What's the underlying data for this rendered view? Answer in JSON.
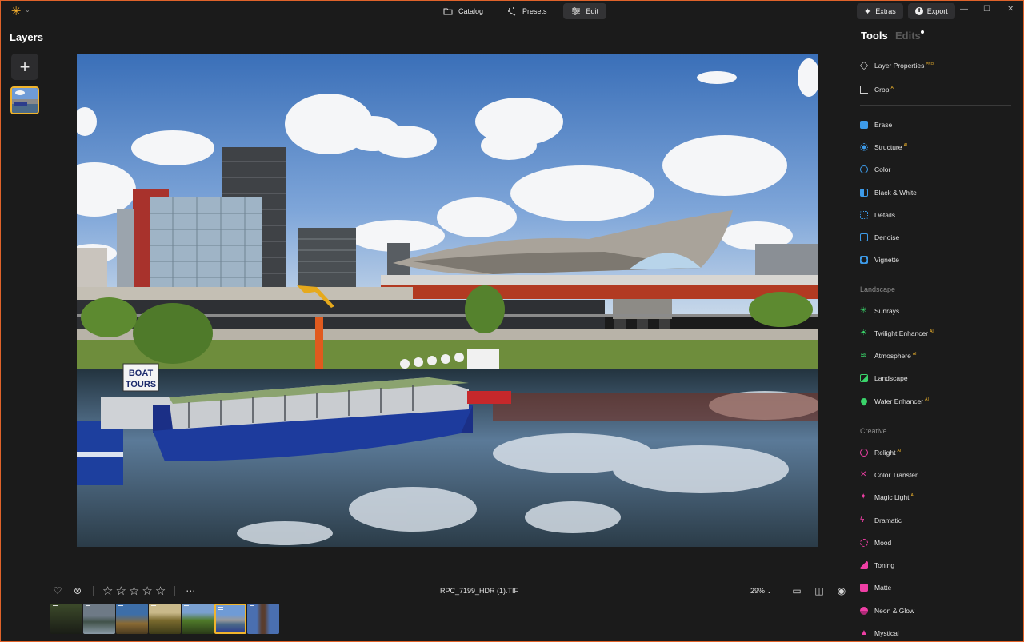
{
  "titlebar": {
    "nav": [
      {
        "label": "Catalog",
        "icon": "folder-icon",
        "active": false
      },
      {
        "label": "Presets",
        "icon": "magic-wand-icon",
        "active": false
      },
      {
        "label": "Edit",
        "icon": "sliders-icon",
        "active": true
      }
    ],
    "extras_label": "Extras",
    "export_label": "Export"
  },
  "layers": {
    "title": "Layers"
  },
  "canvas": {
    "boat_sign": [
      "BOAT",
      "TOURS"
    ]
  },
  "bottom": {
    "filename": "RPC_7199_HDR (1).TIF",
    "zoom": "29%",
    "rating_stars": 5
  },
  "filmstrip": {
    "count": 7,
    "active_index": 5
  },
  "tools": {
    "tab_tools": "Tools",
    "tab_edits": "Edits",
    "top": [
      {
        "label": "Layer Properties",
        "badge": "PRO",
        "icon": "layers-icon",
        "color": "#cfcfcf"
      },
      {
        "label": "Crop",
        "badge": "AI",
        "icon": "crop-icon",
        "color": "#cfcfcf"
      }
    ],
    "essentials": [
      {
        "label": "Erase",
        "badge": "",
        "icon": "erase-icon",
        "color": "#3d9be9"
      },
      {
        "label": "Structure",
        "badge": "AI",
        "icon": "structure-icon",
        "color": "#3d9be9"
      },
      {
        "label": "Color",
        "badge": "",
        "icon": "color-icon",
        "color": "#3d9be9"
      },
      {
        "label": "Black & White",
        "badge": "",
        "icon": "black-white-icon",
        "color": "#3d9be9"
      },
      {
        "label": "Details",
        "badge": "",
        "icon": "details-icon",
        "color": "#3d9be9"
      },
      {
        "label": "Denoise",
        "badge": "",
        "icon": "denoise-icon",
        "color": "#3d9be9"
      },
      {
        "label": "Vignette",
        "badge": "",
        "icon": "vignette-icon",
        "color": "#3d9be9"
      }
    ],
    "landscape_label": "Landscape",
    "landscape": [
      {
        "label": "Sunrays",
        "badge": "",
        "icon": "sunrays-icon",
        "color": "#3ad46a"
      },
      {
        "label": "Twilight Enhancer",
        "badge": "AI",
        "icon": "twilight-icon",
        "color": "#3ad46a"
      },
      {
        "label": "Atmosphere",
        "badge": "AI",
        "icon": "atmosphere-icon",
        "color": "#3ad46a"
      },
      {
        "label": "Landscape",
        "badge": "",
        "icon": "landscape-icon",
        "color": "#3ad46a"
      },
      {
        "label": "Water Enhancer",
        "badge": "AI",
        "icon": "water-drop-icon",
        "color": "#3ad46a"
      }
    ],
    "creative_label": "Creative",
    "creative": [
      {
        "label": "Relight",
        "badge": "AI",
        "icon": "relight-icon",
        "color": "#ef3fa5"
      },
      {
        "label": "Color Transfer",
        "badge": "",
        "icon": "color-transfer-icon",
        "color": "#ef3fa5"
      },
      {
        "label": "Magic Light",
        "badge": "AI",
        "icon": "magic-light-icon",
        "color": "#ef3fa5"
      },
      {
        "label": "Dramatic",
        "badge": "",
        "icon": "dramatic-icon",
        "color": "#ef3fa5"
      },
      {
        "label": "Mood",
        "badge": "",
        "icon": "mood-icon",
        "color": "#ef3fa5"
      },
      {
        "label": "Toning",
        "badge": "",
        "icon": "toning-icon",
        "color": "#ef3fa5"
      },
      {
        "label": "Matte",
        "badge": "",
        "icon": "matte-icon",
        "color": "#ef3fa5"
      },
      {
        "label": "Neon & Glow",
        "badge": "",
        "icon": "neon-glow-icon",
        "color": "#ef3fa5"
      },
      {
        "label": "Mystical",
        "badge": "",
        "icon": "mystical-icon",
        "color": "#ef3fa5"
      }
    ]
  },
  "colors": {
    "accent": "#f0b42c",
    "window_border": "#e0632a",
    "background": "#1b1b1b"
  }
}
